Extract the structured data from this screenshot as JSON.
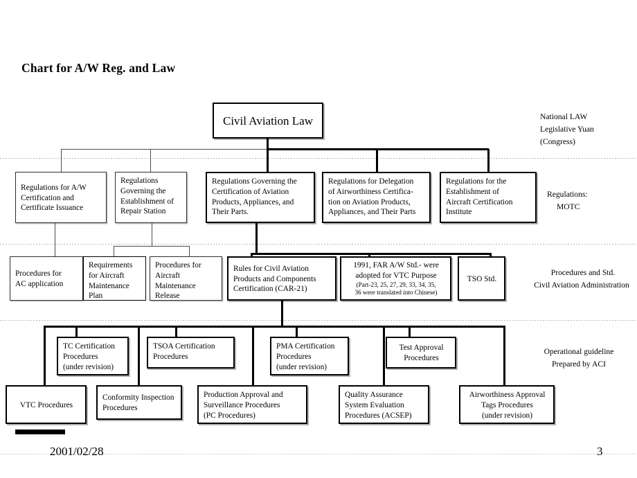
{
  "slide": {
    "title": "Chart for A/W Reg. and Law",
    "footer_date": "2001/02/28",
    "footer_page": "3"
  },
  "colors": {
    "line": "#000000",
    "line_thin": "#4a4a57",
    "text": "#000000",
    "background": "#ffffff",
    "band_divider": "#b9b9b9"
  },
  "side_labels": {
    "law": {
      "l1": "National  LAW",
      "l2": "Legislative Yuan",
      "l3": "(Congress)"
    },
    "regulations": {
      "l1": "Regulations:",
      "l2": "MOTC"
    },
    "procedures": {
      "l1": "Procedures and Std.",
      "l2": "Civil Aviation Administration"
    },
    "operational": {
      "l1": "Operational guideline",
      "l2": "Prepared by ACI"
    }
  },
  "root": {
    "l1": "Civil Aviation Law"
  },
  "regulations_row": {
    "aw_certification": {
      "l1": "Regulations for A/W",
      "l2": "Certification and",
      "l3": "Certificate Issuance"
    },
    "repair_station": {
      "l1": "Regulations",
      "l2": "Governing the",
      "l3": "Establishment of",
      "l4": "Repair Station"
    },
    "product_certification": {
      "l1": "Regulations Governing the",
      "l2": "Certification of Aviation",
      "l3": "Products, Appliances, and",
      "l4": "Their Parts."
    },
    "delegation": {
      "l1": "Regulations for Delegation",
      "l2": "of Airworthiness Certifica-",
      "l3": "tion on Aviation Products,",
      "l4": "Appliances, and Their Parts"
    },
    "certification_institute": {
      "l1": "Regulations for the",
      "l2": "Establishment of",
      "l3": "Aircraft Certification",
      "l4": "Institute"
    }
  },
  "procedures_row": {
    "ac_application": {
      "l1": "Procedures for",
      "l2": "AC application"
    },
    "maintenance_plan": {
      "l1": "Requirements",
      "l2": "for Aircraft",
      "l3": "Maintenance",
      "l4": "Plan"
    },
    "maintenance_release": {
      "l1": "Procedures for",
      "l2": "Aircraft",
      "l3": "Maintenance",
      "l4": "Release"
    },
    "car21": {
      "l1": "Rules for Civil Aviation",
      "l2": "Products and Components",
      "l3": "Certification (CAR-21)"
    },
    "far_std": {
      "l1": "1991, FAR A/W Std.- were",
      "l2": "adopted for VTC Purpose",
      "l3": "(Part-23, 25, 27, 29, 33, 34, 35,",
      "l4": "36 were translated into Chinese)"
    },
    "tso_std": {
      "l1": "TSO Std."
    }
  },
  "guideline_row": {
    "tc_certification": {
      "l1": "TC Certification",
      "l2": "Procedures",
      "l3": "(under revision)"
    },
    "tsoa_certification": {
      "l1": "TSOA Certification",
      "l2": "Procedures"
    },
    "pma_certification": {
      "l1": "PMA Certification",
      "l2": "Procedures",
      "l3": "(under revision)"
    },
    "test_approval": {
      "l1": "Test Approval",
      "l2": "Procedures"
    }
  },
  "guideline_row2": {
    "vtc": {
      "l1": "VTC  Procedures"
    },
    "conformity": {
      "l1": "Conformity Inspection",
      "l2": "Procedures"
    },
    "production_approval": {
      "l1": "Production Approval and",
      "l2": "Surveillance Procedures",
      "l3": "(PC Procedures)"
    },
    "quality_assurance": {
      "l1": "Quality Assurance",
      "l2": "System Evaluation",
      "l3": "Procedures (ACSEP)"
    },
    "airworthiness_tags": {
      "l1": "Airworthiness Approval",
      "l2": "Tags Procedures",
      "l3": "(under revision)"
    }
  },
  "chart_data": {
    "type": "diagram",
    "title": "Chart for A/W Reg. and Law",
    "diagram_kind": "hierarchical organization / regulation chart",
    "bands": [
      {
        "name": "National LAW / Legislative Yuan (Congress)",
        "nodes": [
          "Civil Aviation Law"
        ]
      },
      {
        "name": "Regulations: MOTC",
        "nodes": [
          "Regulations for A/W Certification and Certificate Issuance",
          "Regulations Governing the Establishment of Repair Station",
          "Regulations Governing the Certification of Aviation Products, Appliances, and Their Parts.",
          "Regulations for Delegation of Airworthiness Certification on Aviation Products, Appliances, and Their Parts",
          "Regulations for the Establishment of Aircraft Certification Institute"
        ]
      },
      {
        "name": "Procedures and Std. / Civil Aviation Administration",
        "nodes": [
          "Procedures for AC application",
          "Requirements for Aircraft Maintenance Plan",
          "Procedures for Aircraft Maintenance Release",
          "Rules for Civil Aviation Products and Components Certification (CAR-21)",
          "1991, FAR A/W Std.- were adopted for VTC Purpose (Part-23, 25, 27, 29, 33, 34, 35, 36 were translated into Chinese)",
          "TSO Std."
        ]
      },
      {
        "name": "Operational guideline / Prepared by ACI",
        "nodes": [
          "TC Certification Procedures (under revision)",
          "TSOA Certification Procedures",
          "PMA Certification Procedures (under revision)",
          "Test Approval Procedures",
          "VTC  Procedures",
          "Conformity Inspection Procedures",
          "Production Approval and Surveillance Procedures (PC Procedures)",
          "Quality Assurance System Evaluation Procedures (ACSEP)",
          "Airworthiness Approval Tags Procedures (under revision)"
        ]
      }
    ],
    "edges": [
      {
        "from": "Civil Aviation Law",
        "to": "Regulations for A/W Certification and Certificate Issuance"
      },
      {
        "from": "Civil Aviation Law",
        "to": "Regulations Governing the Establishment of Repair Station"
      },
      {
        "from": "Civil Aviation Law",
        "to": "Regulations Governing the Certification of Aviation Products, Appliances, and Their Parts."
      },
      {
        "from": "Civil Aviation Law",
        "to": "Regulations for Delegation of Airworthiness Certification on Aviation Products, Appliances, and Their Parts"
      },
      {
        "from": "Civil Aviation Law",
        "to": "Regulations for the Establishment of Aircraft Certification Institute"
      },
      {
        "from": "Regulations for A/W Certification and Certificate Issuance",
        "to": "Procedures for AC application"
      },
      {
        "from": "Regulations Governing the Establishment of Repair Station",
        "to": "Requirements for Aircraft Maintenance Plan"
      },
      {
        "from": "Regulations Governing the Establishment of Repair Station",
        "to": "Procedures for Aircraft Maintenance Release"
      },
      {
        "from": "Regulations Governing the Certification of Aviation Products, Appliances, and Their Parts.",
        "to": "Rules for Civil Aviation Products and Components Certification (CAR-21)"
      },
      {
        "from": "Regulations Governing the Certification of Aviation Products, Appliances, and Their Parts.",
        "to": "1991, FAR A/W Std.- were adopted for VTC Purpose"
      },
      {
        "from": "Regulations Governing the Certification of Aviation Products, Appliances, and Their Parts.",
        "to": "TSO Std."
      },
      {
        "from": "Rules for Civil Aviation Products and Components Certification (CAR-21)",
        "to": "TC Certification Procedures (under revision)"
      },
      {
        "from": "Rules for Civil Aviation Products and Components Certification (CAR-21)",
        "to": "TSOA Certification Procedures"
      },
      {
        "from": "Rules for Civil Aviation Products and Components Certification (CAR-21)",
        "to": "PMA Certification Procedures (under revision)"
      },
      {
        "from": "Rules for Civil Aviation Products and Components Certification (CAR-21)",
        "to": "Test Approval Procedures"
      },
      {
        "from": "Rules for Civil Aviation Products and Components Certification (CAR-21)",
        "to": "VTC  Procedures"
      },
      {
        "from": "Rules for Civil Aviation Products and Components Certification (CAR-21)",
        "to": "Conformity Inspection Procedures"
      },
      {
        "from": "Rules for Civil Aviation Products and Components Certification (CAR-21)",
        "to": "Production Approval and Surveillance Procedures (PC Procedures)"
      },
      {
        "from": "Rules for Civil Aviation Products and Components Certification (CAR-21)",
        "to": "Quality Assurance System Evaluation Procedures (ACSEP)"
      },
      {
        "from": "Rules for Civil Aviation Products and Components Certification (CAR-21)",
        "to": "Airworthiness Approval Tags Procedures (under revision)"
      }
    ]
  }
}
